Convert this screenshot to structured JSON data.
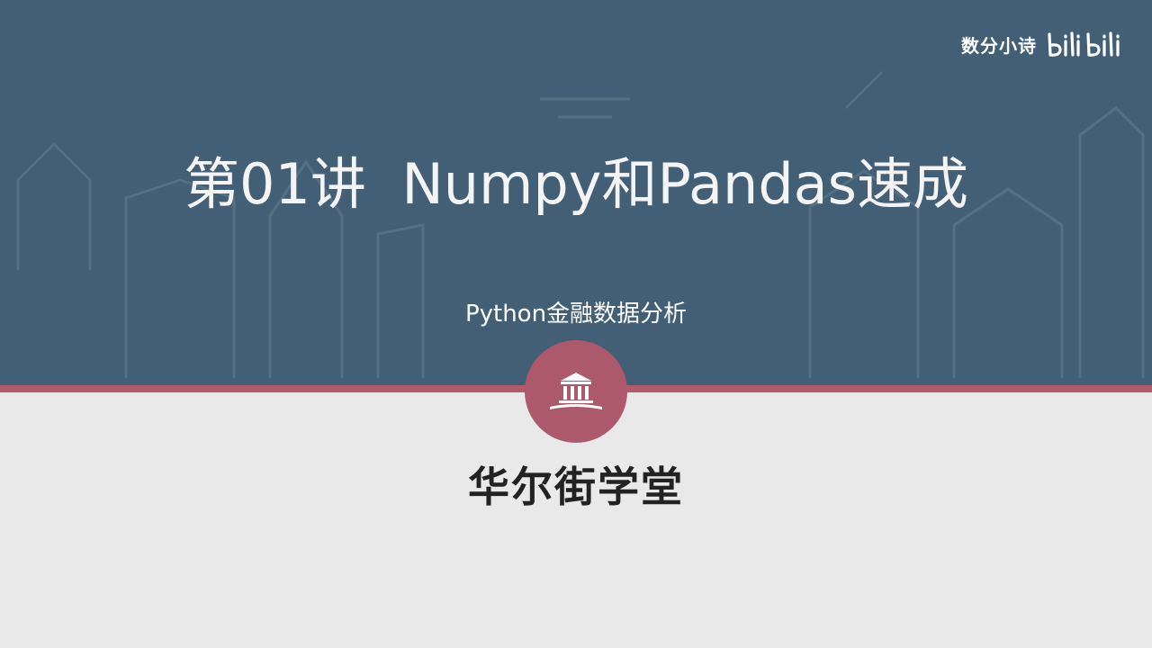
{
  "watermark": {
    "text": "数分小诗",
    "logo_text": "bilibili"
  },
  "slide": {
    "title": "第01讲  Numpy和Pandas速成",
    "subtitle": "Python金融数据分析",
    "emblem_icon": "institution-building-icon",
    "school_name": "华尔街学堂"
  },
  "colors": {
    "top_band": "#425f75",
    "accent": "#b05a6a",
    "bottom": "#e9e9e9"
  }
}
